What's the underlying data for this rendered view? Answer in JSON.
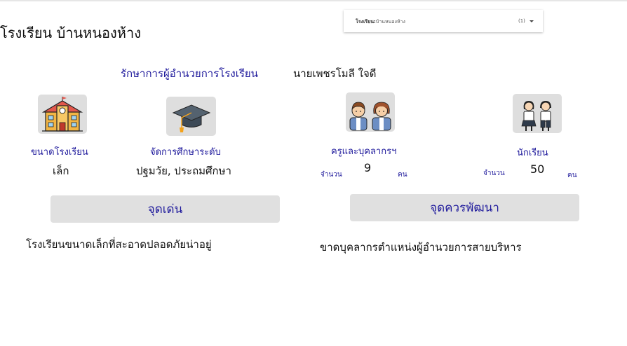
{
  "header": {
    "school_title": "โรงเรียน บ้านหนองห้าง"
  },
  "school_selector": {
    "label": "โรงเรียน:",
    "value": "บ้านหนองห้าง",
    "count": "(1)"
  },
  "director": {
    "label": "รักษาการผู้อำนวยการโรงเรียน",
    "name": "นายเพชรโมลี ใจดี"
  },
  "stats": {
    "school_size": {
      "label": "ขนาดโรงเรียน",
      "value": "เล็ก",
      "icon": "school-building-icon"
    },
    "education_level": {
      "label": "จัดการศึกษาระดับ",
      "value": "ปฐมวัย, ประถมศึกษา",
      "icon": "graduation-cap-icon"
    },
    "teachers": {
      "label": "ครูและบุคลากรฯ",
      "count_label": "จำนวน",
      "count": "9",
      "unit": "คน",
      "icon": "teachers-icon"
    },
    "students": {
      "label": "นักเรียน",
      "count_label": "จำนวน",
      "count": "50",
      "unit": "คน",
      "icon": "students-icon"
    }
  },
  "strengths": {
    "title": "จุดเด่น",
    "text": "โรงเรียนขนาดเล็กที่สะอาดปลอดภัยน่าอยู่"
  },
  "improvements": {
    "title": "จุดควรพัฒนา",
    "text": "ขาดบุคลากรตำแหน่งผู้อำนวยการสายบริหาร"
  },
  "colors": {
    "accent": "#1f1a9c",
    "panel": "#e0e0e0",
    "text": "#111111"
  }
}
